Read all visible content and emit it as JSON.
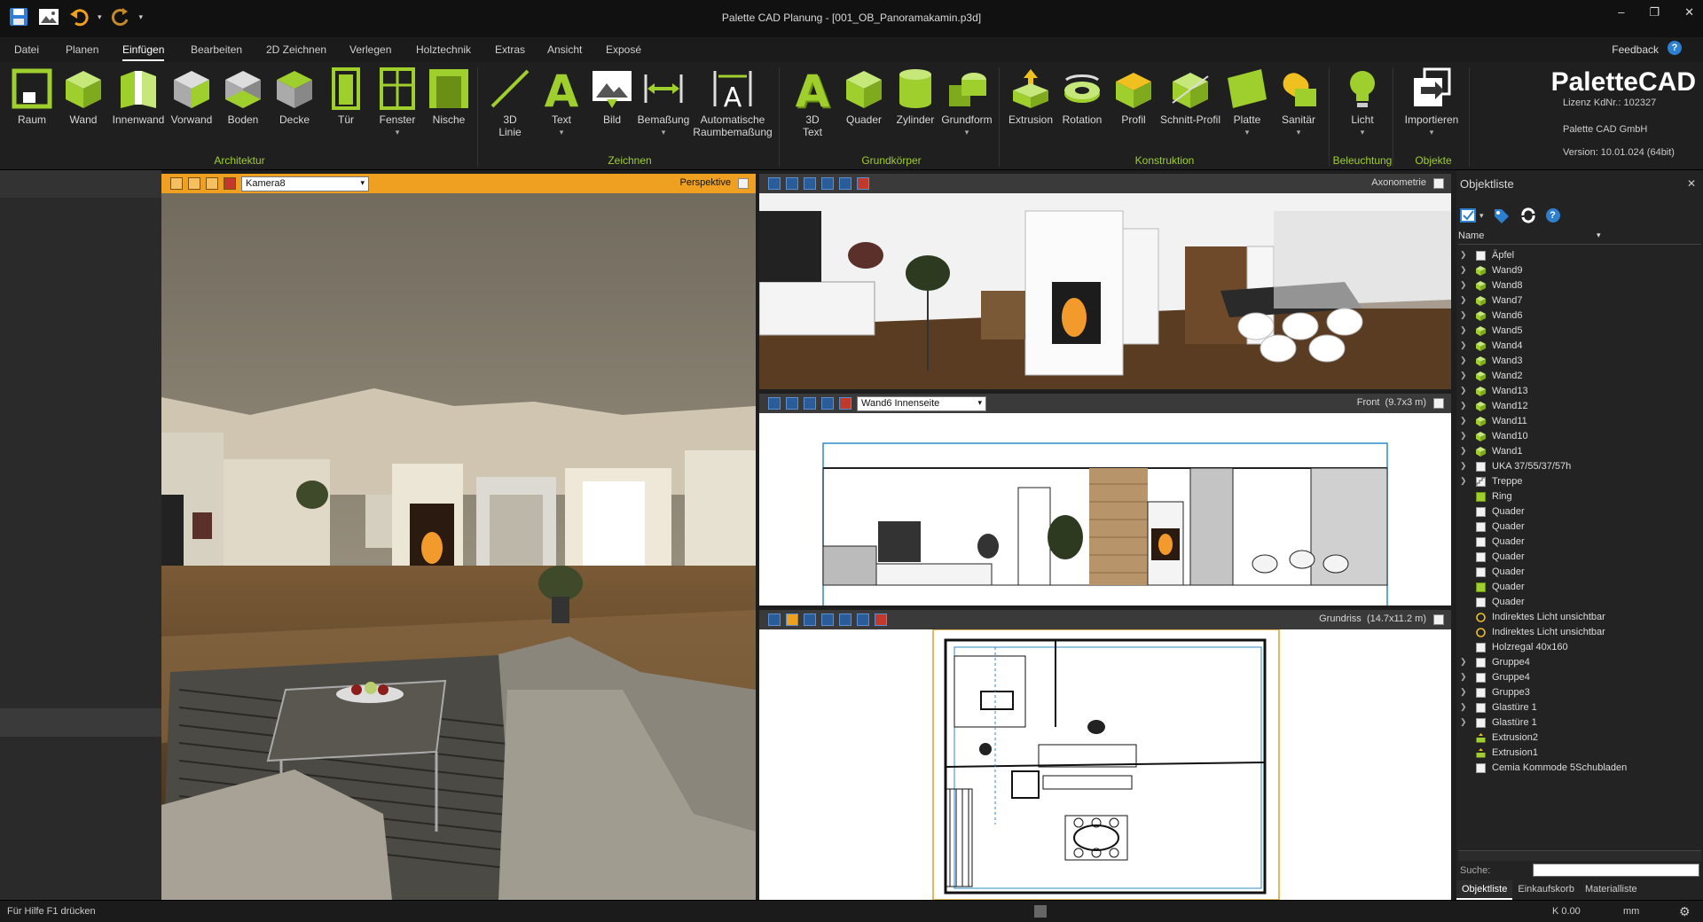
{
  "window": {
    "title": "Palette CAD Planung - [001_OB_Panoramakamin.p3d]",
    "controls": {
      "minimize": "–",
      "restore": "❐",
      "close": "✕"
    }
  },
  "menu": {
    "tabs": [
      "Datei",
      "Planen",
      "Einfügen",
      "Bearbeiten",
      "2D Zeichnen",
      "Verlegen",
      "Holztechnik",
      "Extras",
      "Ansicht",
      "Exposé"
    ],
    "active": "Einfügen",
    "feedback": "Feedback",
    "help": "?"
  },
  "ribbon": {
    "groups": {
      "architektur": "Architektur",
      "zeichnen": "Zeichnen",
      "grundkoerper": "Grundkörper",
      "konstruktion": "Konstruktion",
      "beleuchtung": "Beleuchtung",
      "objekte": "Objekte"
    },
    "buttons": {
      "raum": "Raum",
      "wand": "Wand",
      "innenwand": "Innenwand",
      "vorwand": "Vorwand",
      "boden": "Boden",
      "decke": "Decke",
      "tuer": "Tür",
      "fenster": "Fenster",
      "nische": "Nische",
      "linie_1": "3D",
      "linie_2": "Linie",
      "text": "Text",
      "bild": "Bild",
      "bemassung": "Bemaßung",
      "autobem_1": "Automatische",
      "autobem_2": "Raumbemaßung",
      "text3d_1": "3D",
      "text3d_2": "Text",
      "quader": "Quader",
      "zylinder": "Zylinder",
      "grundform": "Grundform",
      "extrusion": "Extrusion",
      "rotation": "Rotation",
      "profil": "Profil",
      "schnittprofil": "Schnitt-Profil",
      "platte": "Platte",
      "sanitaer": "Sanitär",
      "licht": "Licht",
      "importieren": "Importieren"
    },
    "dropdown_marker": "▾"
  },
  "brand": {
    "logo_palette": "Palette",
    "logo_cad": "CAD",
    "license": "Lizenz KdNr.: 102327",
    "company": "Palette CAD GmbH",
    "version": "Version: 10.01.024 (64bit)"
  },
  "viewports": {
    "perspective": {
      "camera": "Kamera8",
      "label": "Perspektive"
    },
    "axonometrie": {
      "label": "Axonometrie"
    },
    "front": {
      "wall": "Wand6 Innenseite",
      "label": "Front",
      "size": "(9.7x3 m)"
    },
    "grundriss": {
      "label": "Grundriss",
      "size": "(14.7x11.2 m)"
    }
  },
  "objektliste": {
    "title": "Objektliste",
    "close": "✕",
    "column": "Name",
    "items": [
      {
        "label": "Äpfel",
        "expand": true,
        "icon": "white-box"
      },
      {
        "label": "Wand9",
        "expand": true,
        "icon": "green-wall"
      },
      {
        "label": "Wand8",
        "expand": true,
        "icon": "green-wall"
      },
      {
        "label": "Wand7",
        "expand": true,
        "icon": "green-wall"
      },
      {
        "label": "Wand6",
        "expand": true,
        "icon": "green-wall"
      },
      {
        "label": "Wand5",
        "expand": true,
        "icon": "green-wall"
      },
      {
        "label": "Wand4",
        "expand": true,
        "icon": "green-wall"
      },
      {
        "label": "Wand3",
        "expand": true,
        "icon": "green-wall"
      },
      {
        "label": "Wand2",
        "expand": true,
        "icon": "green-wall"
      },
      {
        "label": "Wand13",
        "expand": true,
        "icon": "green-wall"
      },
      {
        "label": "Wand12",
        "expand": true,
        "icon": "green-wall"
      },
      {
        "label": "Wand11",
        "expand": true,
        "icon": "green-wall"
      },
      {
        "label": "Wand10",
        "expand": true,
        "icon": "green-wall"
      },
      {
        "label": "Wand1",
        "expand": true,
        "icon": "green-wall"
      },
      {
        "label": "UKA 37/55/37/57h",
        "expand": true,
        "icon": "white-box"
      },
      {
        "label": "Treppe",
        "expand": true,
        "icon": "stairs"
      },
      {
        "label": "Ring",
        "expand": false,
        "icon": "green-box"
      },
      {
        "label": "Quader",
        "expand": false,
        "icon": "white-box"
      },
      {
        "label": "Quader",
        "expand": false,
        "icon": "white-box"
      },
      {
        "label": "Quader",
        "expand": false,
        "icon": "white-box"
      },
      {
        "label": "Quader",
        "expand": false,
        "icon": "white-box"
      },
      {
        "label": "Quader",
        "expand": false,
        "icon": "white-box"
      },
      {
        "label": "Quader",
        "expand": false,
        "icon": "green-box"
      },
      {
        "label": "Quader",
        "expand": false,
        "icon": "white-box"
      },
      {
        "label": "Indirektes Licht unsichtbar",
        "expand": false,
        "icon": "light-ring"
      },
      {
        "label": "Indirektes Licht unsichtbar",
        "expand": false,
        "icon": "light-ring"
      },
      {
        "label": "Holzregal 40x160",
        "expand": false,
        "icon": "white-box"
      },
      {
        "label": "Gruppe4",
        "expand": true,
        "icon": "white-box"
      },
      {
        "label": "Gruppe4",
        "expand": true,
        "icon": "white-box"
      },
      {
        "label": "Gruppe3",
        "expand": true,
        "icon": "white-box"
      },
      {
        "label": "Glastüre 1",
        "expand": true,
        "icon": "white-box"
      },
      {
        "label": "Glastüre 1",
        "expand": true,
        "icon": "white-box"
      },
      {
        "label": "Extrusion2",
        "expand": false,
        "icon": "extrusion"
      },
      {
        "label": "Extrusion1",
        "expand": false,
        "icon": "extrusion"
      },
      {
        "label": "Cemia Kommode 5Schubladen",
        "expand": false,
        "icon": "white-box"
      }
    ],
    "search_label": "Suche:",
    "tabs": [
      "Objektliste",
      "Einkaufskorb",
      "Materialliste"
    ]
  },
  "status": {
    "help": "Für Hilfe F1 drücken",
    "cost": "K 0.00",
    "unit": "mm"
  },
  "colors": {
    "accent_green": "#9fcf2c",
    "perspective_bar": "#f0a020",
    "help_blue": "#2d7fd0"
  }
}
